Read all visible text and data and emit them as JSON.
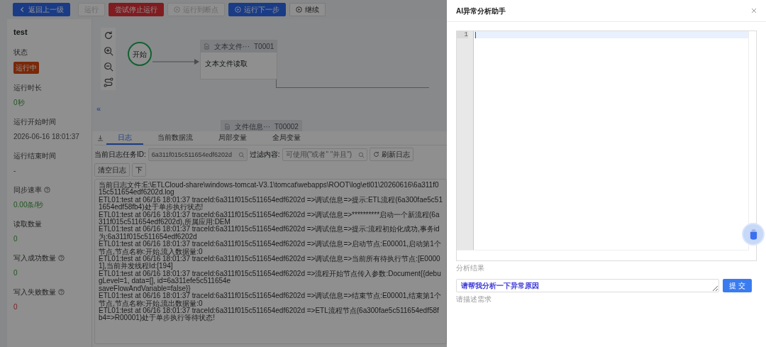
{
  "toolbar": [
    {
      "label": "返回上一级",
      "kind": "back",
      "disabled": false
    },
    {
      "label": "运行",
      "kind": "text",
      "disabled": true
    },
    {
      "label": "尝试停止运行",
      "kind": "stop",
      "disabled": false
    },
    {
      "label": "运行到断点",
      "kind": "play",
      "disabled": true
    },
    {
      "label": "运行下一步",
      "kind": "step",
      "disabled": false
    },
    {
      "label": "继续",
      "kind": "play",
      "disabled": false
    }
  ],
  "info_panel": {
    "title": "test",
    "fields": [
      {
        "label": "状态",
        "help": false,
        "kind": "badge",
        "value": "运行中"
      },
      {
        "label": "运行时长",
        "help": false,
        "kind": "good",
        "value": "0秒"
      },
      {
        "label": "运行开始时间",
        "help": false,
        "kind": "plain",
        "value": "2026-06-16 18:01:37"
      },
      {
        "label": "运行结束时间",
        "help": false,
        "kind": "plain",
        "value": "-"
      },
      {
        "label": "同步速率",
        "help": true,
        "kind": "good",
        "value": "0.00条/秒"
      },
      {
        "label": "读取数量",
        "help": false,
        "kind": "good",
        "value": "0"
      },
      {
        "label": "写入成功数量",
        "help": true,
        "kind": "good",
        "value": "0"
      },
      {
        "label": "写入失败数量",
        "help": true,
        "kind": "bad",
        "value": "0"
      }
    ]
  },
  "canvas": {
    "collapse": "«",
    "nodes": [
      {
        "kind": "start",
        "label": "开始"
      },
      {
        "kind": "task",
        "title": "文本文件···",
        "code": "T0001",
        "body": "文本文件读取"
      },
      {
        "kind": "task",
        "title": "文件信息···",
        "code": "T00002"
      }
    ]
  },
  "tabs": [
    {
      "label": "日志",
      "selected": true
    },
    {
      "label": "当前数据流",
      "selected": false
    },
    {
      "label": "局部变量",
      "selected": false
    },
    {
      "label": "全局变量",
      "selected": false
    }
  ],
  "filters": {
    "task_id": {
      "label": "当前日志任务ID:",
      "value": "6a311f015c511654edf6202d"
    },
    "content": {
      "label": "过滤内容:",
      "placeholder": "可使用(\"或者\" \"并且\")"
    },
    "buttons": [
      {
        "label": "刷新日志",
        "kind": "refresh"
      },
      {
        "label": "清空日志",
        "kind": "text"
      },
      {
        "label": "下",
        "kind": "text"
      }
    ]
  },
  "log_lines": [
    "当前日志文件:E:\\ETLCloud-share\\windows-tomcat-V3.1\\tomcat\\webapps\\ROOT\\log\\etl01\\20260616\\6a311f015c511654edf6202d.log",
    "ETL01:test at 06/16 18:01:37 traceId:6a311f015c511654edf6202d =>调试信息=>提示:ETL流程(6a300fae5c511654edf58fb4)处于单步执行状态!",
    "ETL01:test at 06/16 18:01:37 traceId:6a311f015c511654edf6202d =>调试信息=>**********启动一个新流程(6a311f015c511654edf6202d),所属应用:DEM",
    "ETL01:test at 06/16 18:01:37 traceId:6a311f015c511654edf6202d =>调试信息=>提示:流程初始化成功,事务id为:6a311f015c511654edf6202d",
    "ETL01:test at 06/16 18:01:37 traceId:6a311f015c511654edf6202d =>调试信息=>启动节点:E00001,启动第1个节点,节点名称:开始,流入数据量:0",
    "ETL01:test at 06/16 18:01:37 traceId:6a311f015c511654edf6202d =>调试信息=>当前所有待执行节点:[E00001],当前并发线程Id:[194]",
    "ETL01:test at 06/16 18:01:37 traceId:6a311f015c511654edf6202d =>流程开始节点传入参数:Document{{debugLevel=1, data=[], id=6a311efe5c511654e",
    "saveFlowAndVariable=false}}",
    "ETL01:test at 06/16 18:01:37 traceId:6a311f015c511654edf6202d =>调试信息=>结束节点:E00001,结束第1个节点,节点名称:开始,流出数据量:0",
    "ETL01:test at 06/16 18:01:37 traceId:6a311f015c511654edf6202d =>ETL流程节点(6a300fae5c511654edf58fb4=>R00001)处于单步执行等待状态!"
  ],
  "drawer": {
    "title": "AI异常分析助手",
    "editor": {
      "line_numbers": [
        "1"
      ]
    },
    "result_label": "分析结果",
    "prompt": {
      "value": "请帮我分析一下异常原因",
      "label": "请描述需求"
    },
    "submit": "提 交"
  }
}
